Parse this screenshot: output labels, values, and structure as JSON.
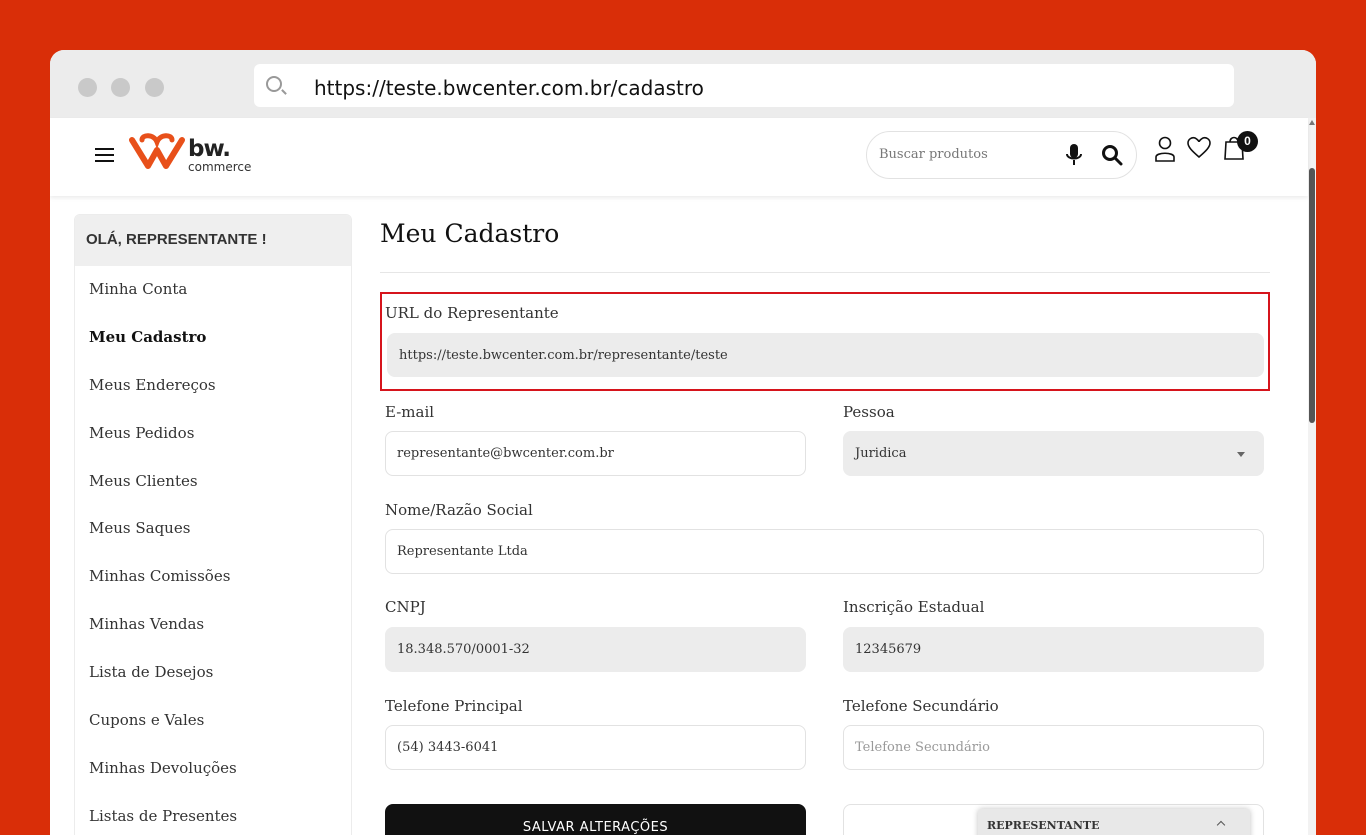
{
  "browser": {
    "url": "https://teste.bwcenter.com.br/cadastro"
  },
  "header": {
    "logo_name": "bw.",
    "logo_sub": "commerce",
    "search_placeholder": "Buscar produtos",
    "cart_count": "0"
  },
  "sidebar": {
    "greeting": "OLÁ, REPRESENTANTE !",
    "items": [
      {
        "label": "Minha Conta"
      },
      {
        "label": "Meu Cadastro"
      },
      {
        "label": "Meus Endereços"
      },
      {
        "label": "Meus Pedidos"
      },
      {
        "label": "Meus Clientes"
      },
      {
        "label": "Meus Saques"
      },
      {
        "label": "Minhas Comissões"
      },
      {
        "label": "Minhas Vendas"
      },
      {
        "label": "Lista de Desejos"
      },
      {
        "label": "Cupons e Vales"
      },
      {
        "label": "Minhas Devoluções"
      },
      {
        "label": "Listas de Presentes"
      }
    ],
    "active_item": "Meu Cadastro"
  },
  "main": {
    "title": "Meu Cadastro",
    "rep_url_label": "URL do Representante",
    "rep_url_value": "https://teste.bwcenter.com.br/representante/teste",
    "email_label": "E-mail",
    "email_value": "representante@bwcenter.com.br",
    "pessoa_label": "Pessoa",
    "pessoa_value": "Juridica",
    "nome_label": "Nome/Razão Social",
    "nome_value": "Representante Ltda",
    "cnpj_label": "CNPJ",
    "cnpj_value": "18.348.570/0001-32",
    "ie_label": "Inscrição Estadual",
    "ie_value": "12345679",
    "tel1_label": "Telefone Principal",
    "tel1_value": "(54) 3443-6041",
    "tel2_label": "Telefone Secundário",
    "tel2_placeholder": "Telefone Secundário",
    "save_label": "SALVAR ALTERAÇÕES"
  },
  "rep_panel": {
    "label": "REPRESENTANTE"
  },
  "colors": {
    "background": "#d92e08",
    "highlight": "#d6141c",
    "logo_accent": "#e8501a"
  }
}
